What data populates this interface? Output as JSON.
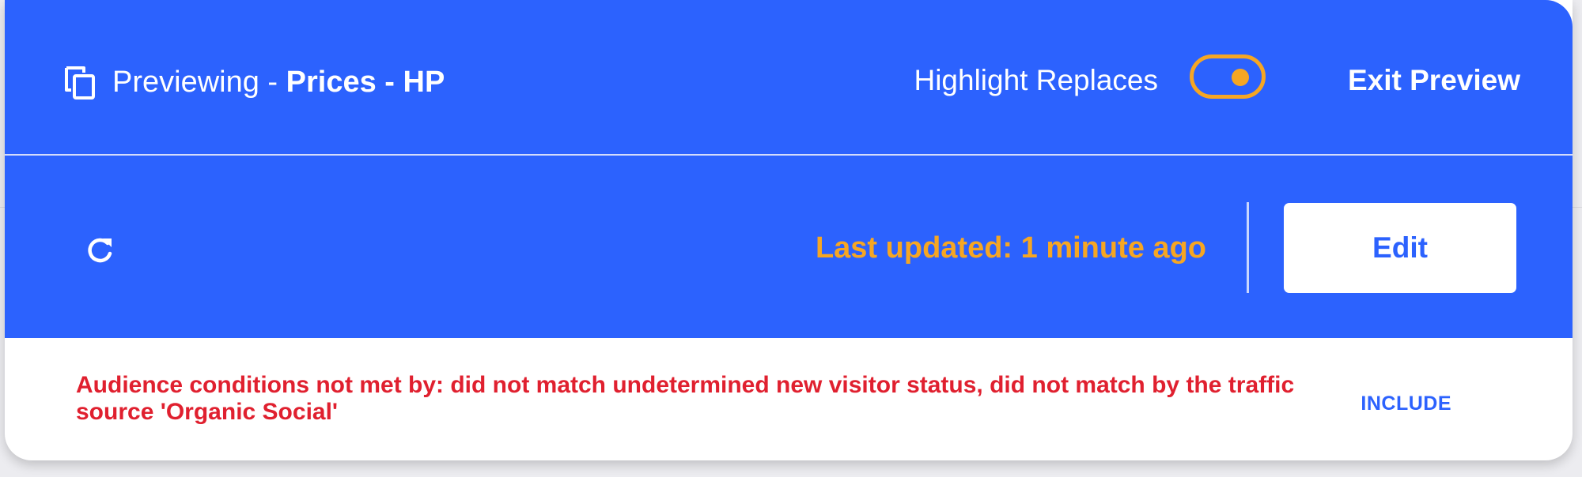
{
  "header": {
    "preview_prefix": "Previewing - ",
    "preview_name": "Prices - HP",
    "highlight_label": "Highlight Replaces",
    "highlight_enabled": true,
    "exit_label": "Exit Preview",
    "copy_icon": "copy-icon"
  },
  "toolbar": {
    "refresh_icon": "refresh-icon",
    "last_updated": "Last updated: 1 minute ago",
    "edit_label": "Edit"
  },
  "audience": {
    "message": "Audience conditions not met by: did not match undetermined new visitor status, did not match by the traffic source 'Organic Social'",
    "include_label": "INCLUDE"
  },
  "colors": {
    "primary": "#2c62fe",
    "accent": "#f6a623",
    "error": "#e0202f",
    "surface": "#ffffff"
  }
}
